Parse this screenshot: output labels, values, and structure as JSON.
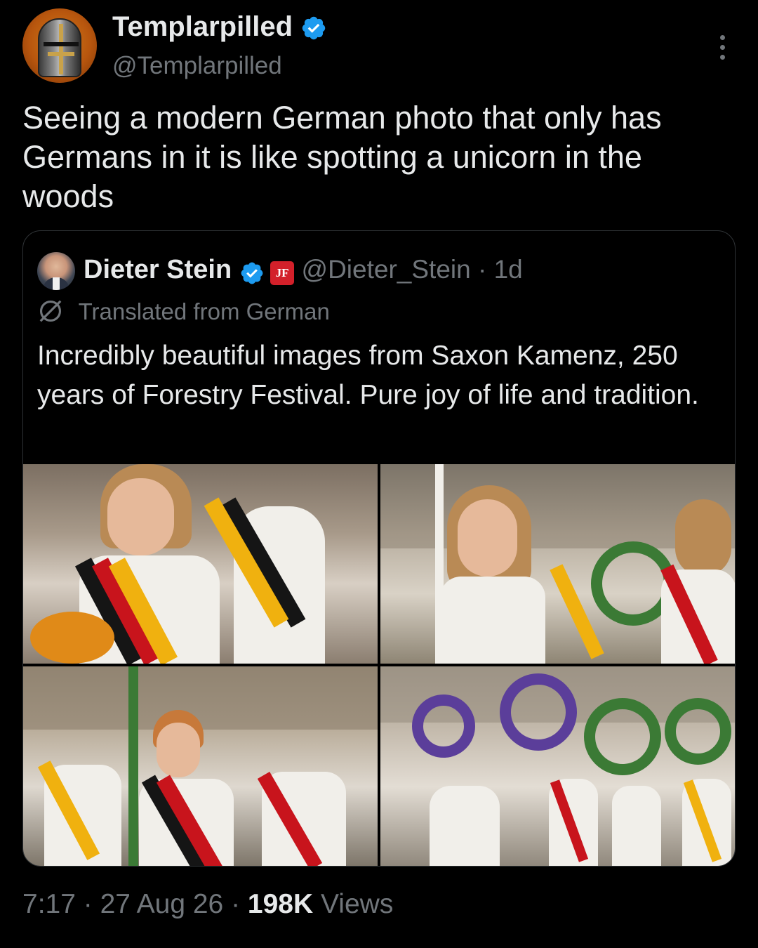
{
  "author": {
    "display_name": "Templarpilled",
    "handle": "@Templarpilled",
    "verified": true
  },
  "tweet": {
    "text": "Seeing a modern German photo that only has Germans in it is like spotting a unicorn in the woods"
  },
  "quoted_tweet": {
    "display_name": "Dieter Stein",
    "verified": true,
    "affiliation_badge": "JF",
    "handle": "@Dieter_Stein",
    "separator": " · ",
    "age": "1d",
    "translated_label": "Translated from German",
    "text": "Incredibly beautiful images from Saxon Kamenz, 250 years of Forestry Festival. Pure joy of life and tradition.",
    "media_count": 4
  },
  "meta": {
    "time": "7:17",
    "sep1": " · ",
    "date": "27 Aug 26",
    "sep2": " · ",
    "views_count": "198K",
    "views_label": " Views"
  },
  "colors": {
    "background": "#000000",
    "text_primary": "#e7e9ea",
    "text_secondary": "#71767b",
    "verified_blue": "#1d9bf0",
    "border": "#2f3336",
    "jf_red": "#d3202a"
  },
  "icons": {
    "more": "more-vertical-icon",
    "verified": "verified-badge-icon",
    "translate": "globe-translate-icon"
  }
}
